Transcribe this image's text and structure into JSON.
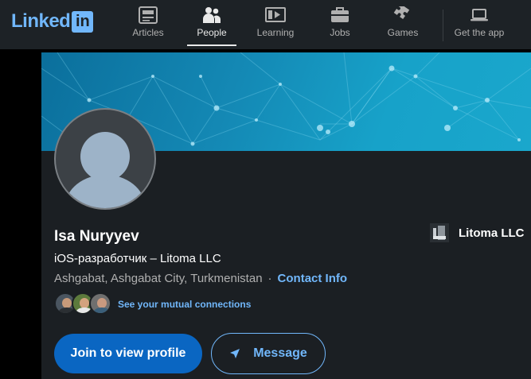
{
  "brand": {
    "logo_text": "Linked",
    "logo_box": "in",
    "accent": "#71b7fb",
    "primary": "#0a66c2"
  },
  "nav": {
    "items": [
      {
        "label": "Articles",
        "icon": "articles-icon"
      },
      {
        "label": "People",
        "icon": "people-icon",
        "active": true
      },
      {
        "label": "Learning",
        "icon": "learning-icon"
      },
      {
        "label": "Jobs",
        "icon": "jobs-icon"
      },
      {
        "label": "Games",
        "icon": "games-icon"
      }
    ],
    "get_app": {
      "label": "Get the app",
      "icon": "laptop-icon"
    }
  },
  "profile": {
    "name": "Isa Nuryyev",
    "headline": "iOS-разработчик – Litoma LLC",
    "location": "Ashgabat, Ashgabat City, Turkmenistan",
    "separator": "·",
    "contact_info": "Contact Info",
    "company": {
      "name": "Litoma LLC"
    },
    "mutual_connections": "See your mutual connections",
    "join_button": "Join to view profile",
    "message_button": "Message"
  }
}
